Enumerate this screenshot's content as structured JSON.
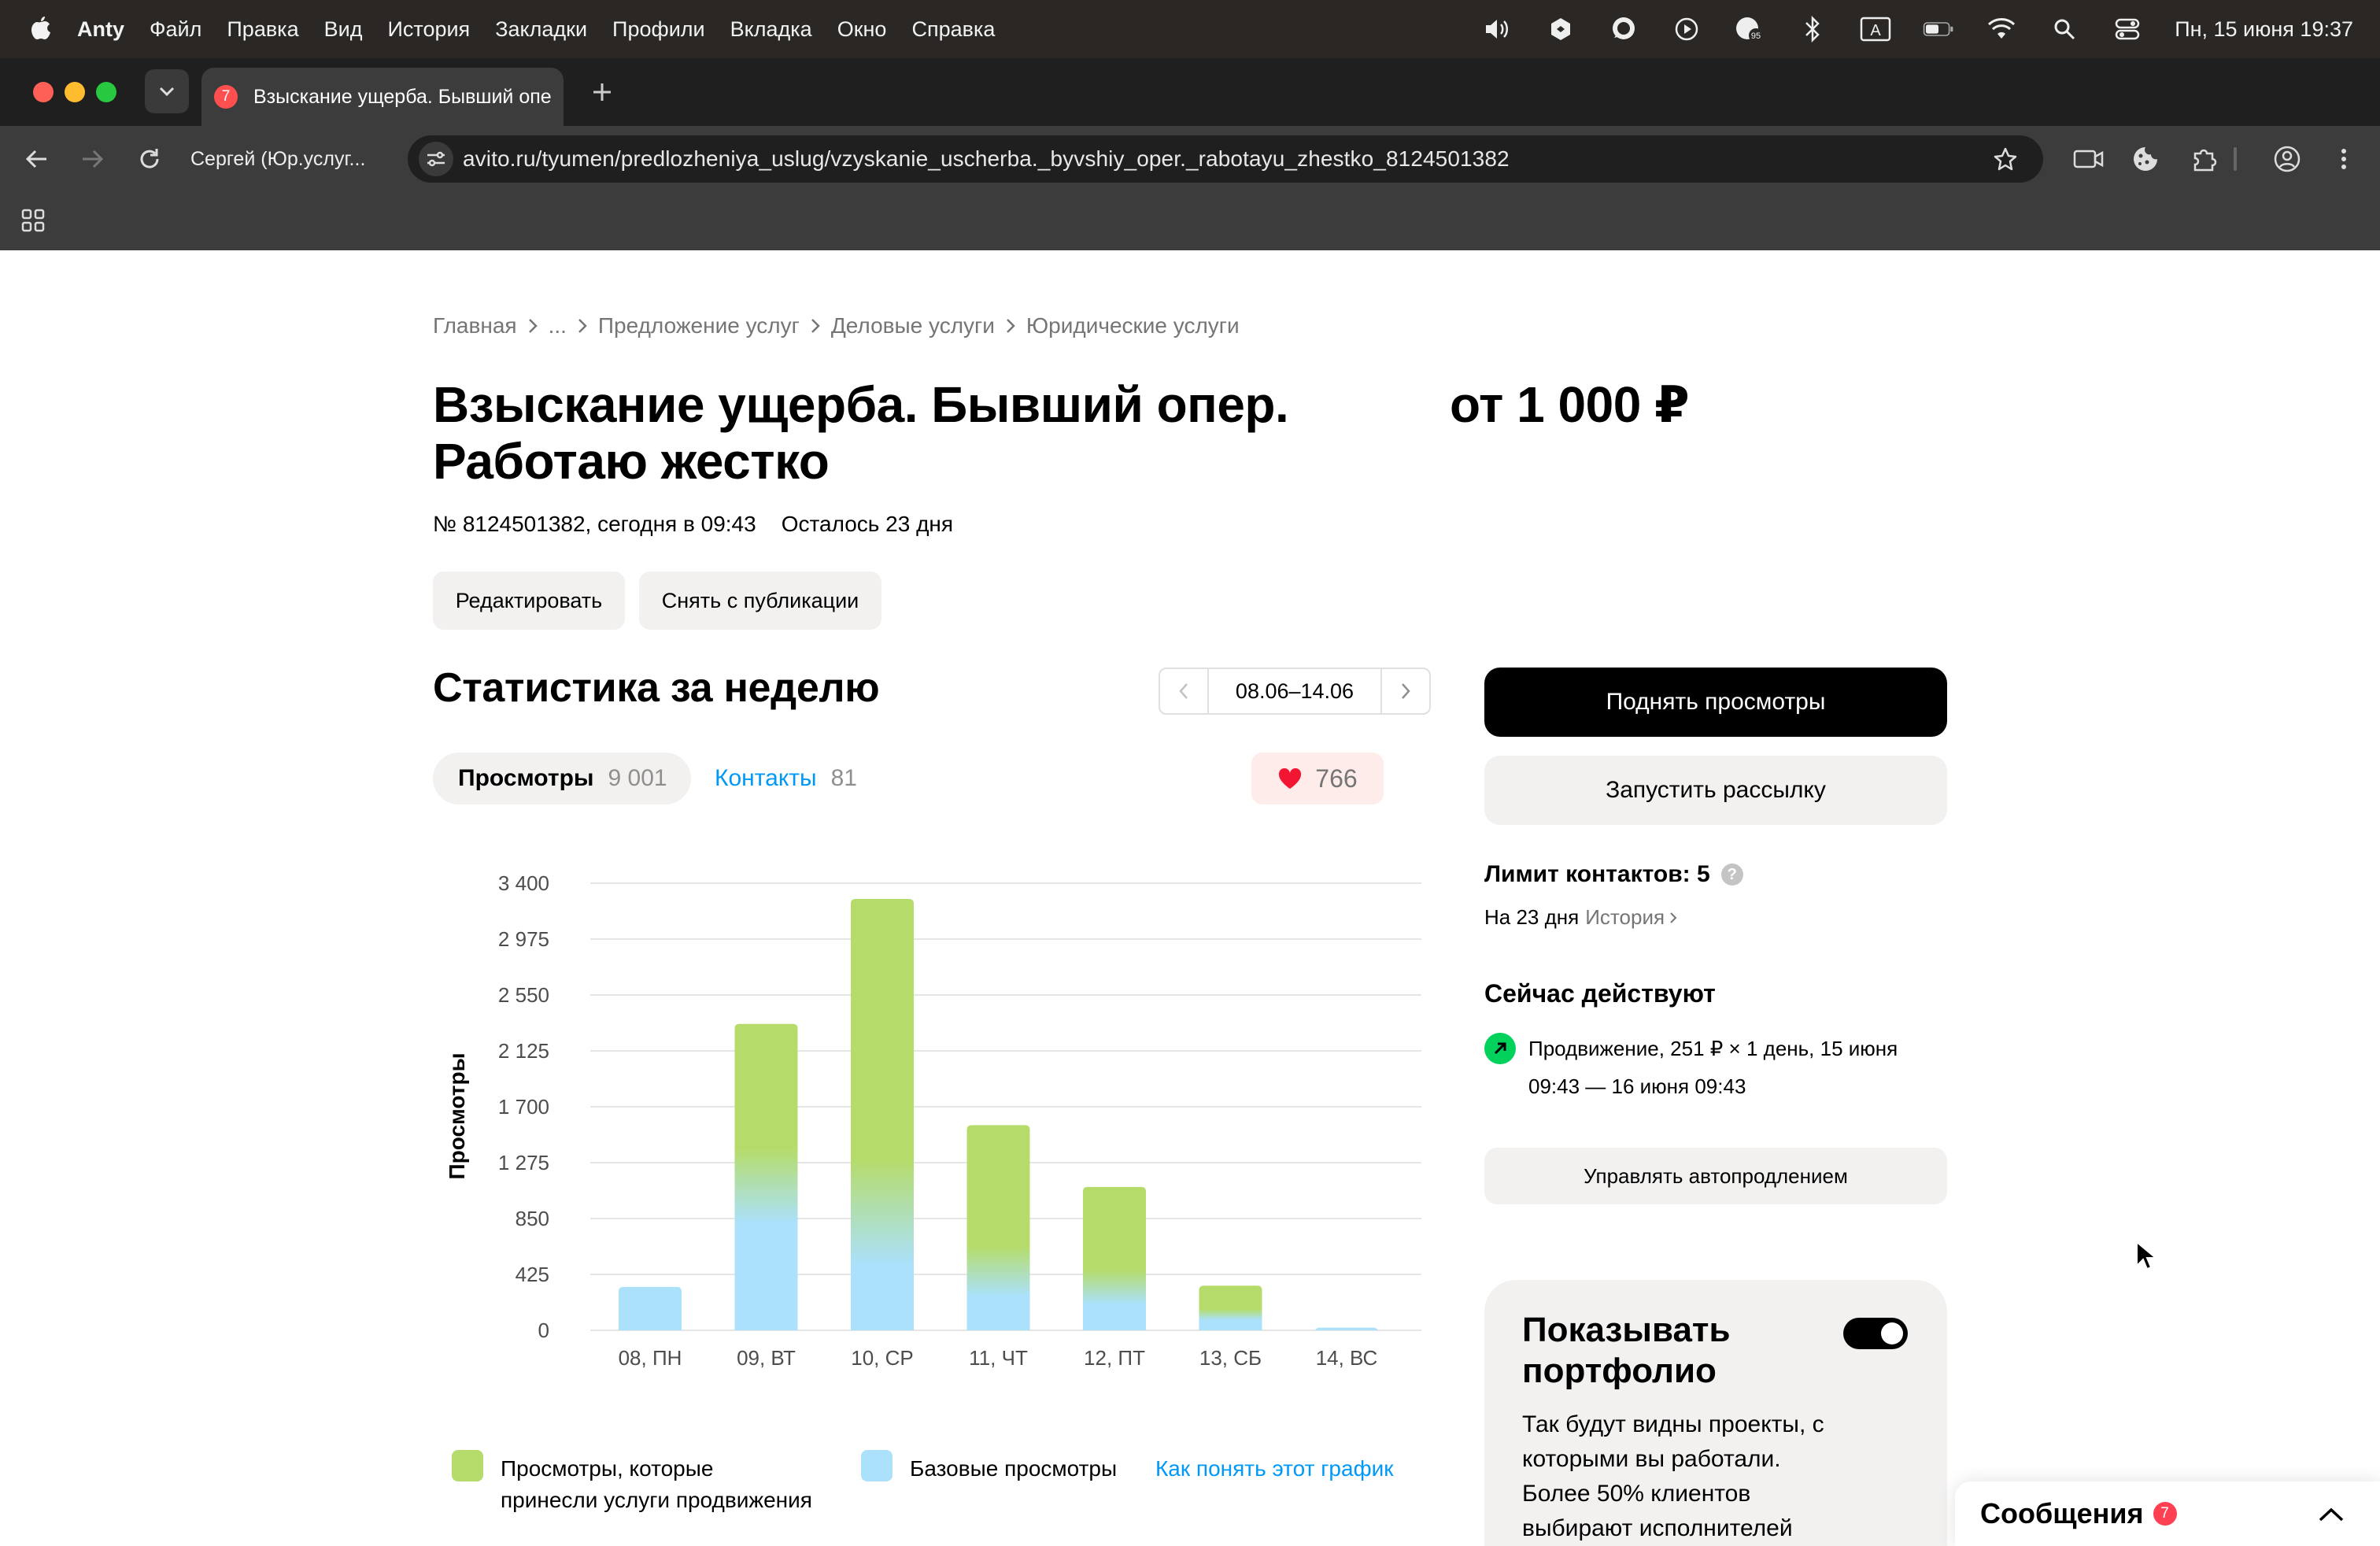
{
  "menubar": {
    "app_name": "Anty",
    "items": [
      "Файл",
      "Правка",
      "Вид",
      "История",
      "Закладки",
      "Профили",
      "Вкладка",
      "Окно",
      "Справка"
    ],
    "clock": "Пн, 15 июня  19:37",
    "status_icons": [
      "volume-icon",
      "dropbox-icon",
      "chat-icon",
      "play-icon",
      "vpn-icon",
      "bluetooth-icon",
      "input-source-icon",
      "battery-icon",
      "wifi-icon",
      "spotlight-icon",
      "control-center-icon"
    ],
    "vpn_badge": "95",
    "input_source": "A"
  },
  "browser": {
    "tab_title": "Взыскание ущерба. Бывший опер.",
    "tab_badge": "7",
    "profile_label": "Сергей (Юр.услуг...",
    "url": "avito.ru/tyumen/predlozheniya_uslug/vzyskanie_uscherba._byvshiy_oper._rabotayu_zhestko_8124501382"
  },
  "breadcrumb": [
    "Главная",
    "...",
    "Предложение услуг",
    "Деловые услуги",
    "Юридические услуги"
  ],
  "listing": {
    "title": "Взыскание ущерба. Бывший опер. Работаю жестко",
    "price": "от 1 000 ₽",
    "number_date": "№ 8124501382, сегодня в 09:43",
    "remaining": "Осталось 23 дня",
    "edit_label": "Редактировать",
    "unpublish_label": "Снять с публикации"
  },
  "stats": {
    "title": "Статистика за неделю",
    "period": "08.06–14.06",
    "views_label": "Просмотры",
    "views_count": "9 001",
    "contacts_label": "Контакты",
    "contacts_count": "81",
    "favorites_count": "766",
    "legend_promo": "Просмотры, которые принесли услуги продвижения",
    "legend_base": "Базовые просмотры",
    "howto_link": "Как понять этот график"
  },
  "chart_data": {
    "type": "bar",
    "stacked": true,
    "ylabel": "Просмотры",
    "ylim": [
      0,
      3400
    ],
    "yticks": [
      0,
      425,
      850,
      1275,
      1700,
      2125,
      2550,
      2975,
      3400
    ],
    "ytick_labels": [
      "0",
      "425",
      "850",
      "1 275",
      "1 700",
      "2 125",
      "2 550",
      "2 975",
      "3 400"
    ],
    "categories": [
      "08, ПН",
      "09, ВТ",
      "10, СР",
      "11, ЧТ",
      "12, ПТ",
      "13, СБ",
      "14, ВС"
    ],
    "series": [
      {
        "name": "Базовые просмотры",
        "color": "#abe1fa",
        "values": [
          330,
          1100,
          900,
          450,
          330,
          120,
          20
        ]
      },
      {
        "name": "Просмотры, которые принесли услуги продвижения",
        "color": "#b5dc6b",
        "values": [
          0,
          1230,
          2380,
          1110,
          760,
          220,
          0
        ]
      }
    ],
    "grid": true,
    "legend": "bottom"
  },
  "sidebar": {
    "raise_views": "Поднять просмотры",
    "mailing": "Запустить рассылку",
    "limit_title": "Лимит контактов: 5",
    "limit_period": "На 23 дня",
    "history": "История",
    "active_title": "Сейчас действуют",
    "promo_text": "Продвижение, 251 ₽ × 1 день, 15 июня 09:43 — 16 июня 09:43",
    "autorenew": "Управлять автопродлением",
    "portfolio_title": "Показывать портфолио",
    "portfolio_desc": "Так будут видны проекты, с которыми вы работали. Более 50% клиентов выбирают исполнителей",
    "portfolio_enabled": true
  },
  "messages": {
    "title": "Сообщения",
    "badge": "7"
  }
}
